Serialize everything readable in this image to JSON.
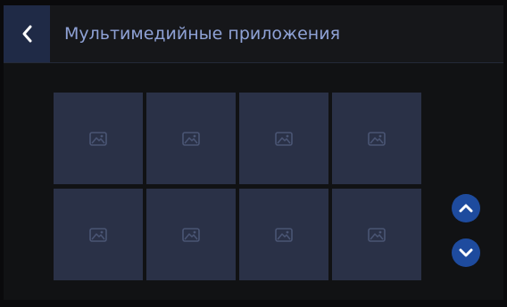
{
  "header": {
    "title": "Мультимедийные приложения",
    "back_icon": "chevron-left-icon"
  },
  "grid": {
    "rows": 2,
    "columns": 4,
    "tiles": [
      {
        "icon": "image-placeholder-icon"
      },
      {
        "icon": "image-placeholder-icon"
      },
      {
        "icon": "image-placeholder-icon"
      },
      {
        "icon": "image-placeholder-icon"
      },
      {
        "icon": "image-placeholder-icon"
      },
      {
        "icon": "image-placeholder-icon"
      },
      {
        "icon": "image-placeholder-icon"
      },
      {
        "icon": "image-placeholder-icon"
      }
    ]
  },
  "scroll_controls": {
    "up_icon": "chevron-up-icon",
    "down_icon": "chevron-down-icon"
  },
  "colors": {
    "background": "#111214",
    "header": "#16171a",
    "back_button": "#1f2a46",
    "title_text": "#8fa2d6",
    "tile": "#2a3147",
    "tile_icon": "#4a5574",
    "scroll_button": "#1e4b9e",
    "icon_white": "#ffffff"
  }
}
